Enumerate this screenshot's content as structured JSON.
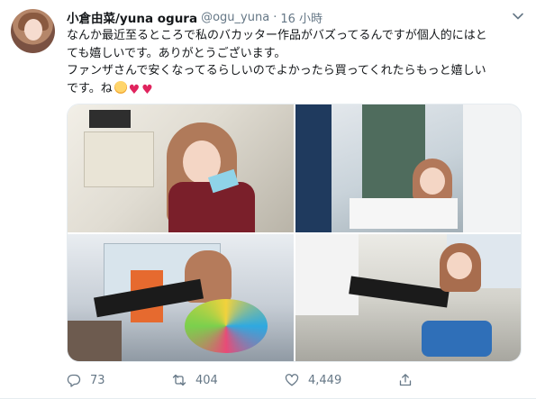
{
  "tweet": {
    "display_name": "小倉由菜/yuna ogura",
    "handle": "@ogu_yuna",
    "separator": "·",
    "time": "16 小時",
    "text_lines": [
      "なんか最近至るところで私のバカッター作品がバズってるんですが個人的にはと",
      "ても嬉しいです。ありがとうございます。",
      "ファンザさんで安くなってるらしいのでよかったら買ってくれたらもっと嬉しい",
      "です。ね"
    ],
    "emojis": [
      "kissing-face",
      "red-heart",
      "red-heart"
    ]
  },
  "actions": {
    "reply_count": "73",
    "retweet_count": "404",
    "like_count": "4,449"
  },
  "colors": {
    "text": "#14171a",
    "secondary": "#657786",
    "heart": "#e0245e",
    "border": "#e6ecf0"
  },
  "icons": [
    "chevron-down-icon",
    "reply-icon",
    "retweet-icon",
    "like-icon",
    "share-icon"
  ]
}
